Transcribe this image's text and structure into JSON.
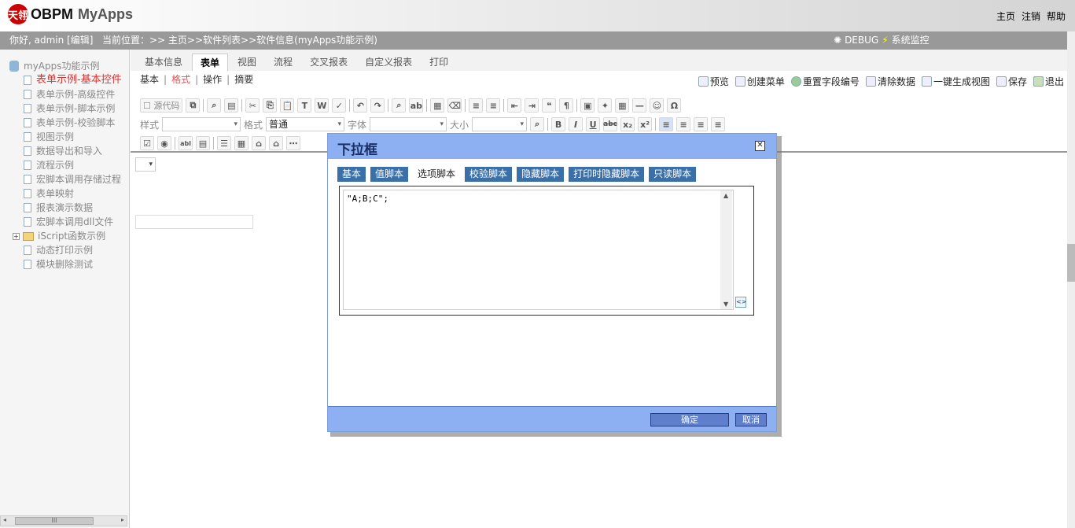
{
  "header": {
    "brand": "OBPM",
    "app_name": "MyApps",
    "logo_mark": "天翎",
    "links": [
      "主页",
      "注销",
      "帮助"
    ]
  },
  "infobar": {
    "greeting": "你好, admin [编辑]",
    "location": "当前位置：>> 主页>>软件列表>>软件信息(myApps功能示例)",
    "debug": "DEBUG",
    "monitor": "系统监控"
  },
  "sidebar": {
    "root": "myApps功能示例",
    "items": [
      {
        "label": "表单示例-基本控件",
        "active": true
      },
      {
        "label": "表单示例-高级控件"
      },
      {
        "label": "表单示例-脚本示例"
      },
      {
        "label": "表单示例-校验脚本"
      },
      {
        "label": "视图示例"
      },
      {
        "label": "数据导出和导入"
      },
      {
        "label": "流程示例"
      },
      {
        "label": "宏脚本调用存储过程"
      },
      {
        "label": "表单映射"
      },
      {
        "label": "报表演示数据"
      },
      {
        "label": "宏脚本调用dll文件"
      }
    ],
    "folder": "iScript函数示例",
    "items_after": [
      "动态打印示例",
      "模块删除测试"
    ],
    "hscroll_thumb": "III"
  },
  "main_tabs": {
    "items": [
      "基本信息",
      "表单",
      "视图",
      "流程",
      "交叉报表",
      "自定义报表",
      "打印"
    ],
    "selected": "表单"
  },
  "sub_tabs": {
    "items": [
      "基本",
      "格式",
      "操作",
      "摘要"
    ],
    "selected": "格式"
  },
  "actions": [
    "预览",
    "创建菜单",
    "重置字段编号",
    "清除数据",
    "一键生成视图",
    "保存",
    "退出"
  ],
  "editor": {
    "source_label": "源代码",
    "style_label": "样式",
    "format_label": "格式",
    "format_value": "普通",
    "font_label": "字体",
    "size_label": "大小"
  },
  "dialog": {
    "title": "下拉框",
    "tabs": [
      "基本",
      "值脚本",
      "选项脚本",
      "校验脚本",
      "隐藏脚本",
      "打印时隐藏脚本",
      "只读脚本"
    ],
    "selected_tab": "选项脚本",
    "code": "\"A;B;C\";",
    "ok": "确定",
    "cancel": "取消"
  }
}
